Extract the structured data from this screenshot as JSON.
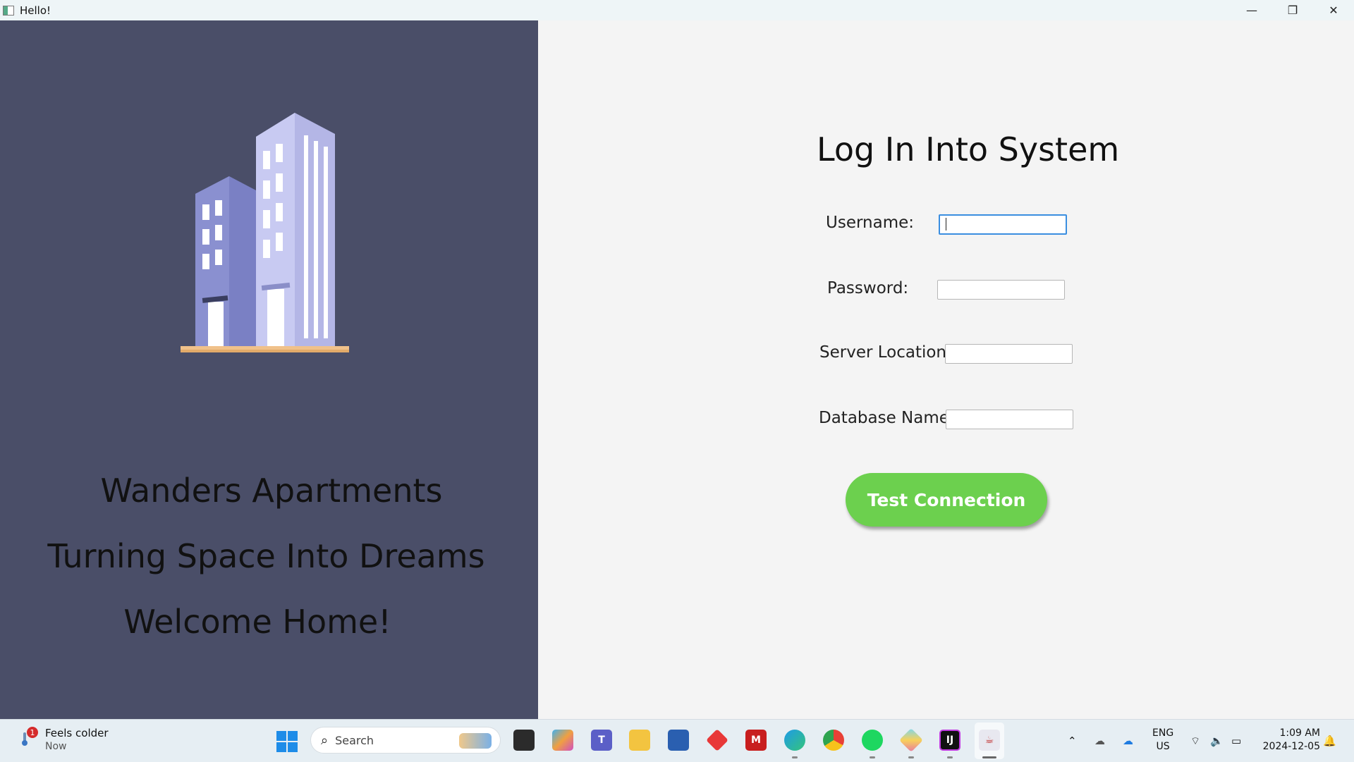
{
  "window": {
    "title": "Hello!",
    "minimize_glyph": "—",
    "maximize_glyph": "❐",
    "close_glyph": "✕"
  },
  "left_panel": {
    "lines": [
      "Wanders Apartments",
      "Turning Space Into Dreams",
      "Welcome Home!"
    ]
  },
  "form": {
    "heading": "Log In Into System",
    "fields": [
      {
        "label": "Username:",
        "value": "",
        "focused": true
      },
      {
        "label": "Password:",
        "value": ""
      },
      {
        "label": "Server Location:",
        "value": ""
      },
      {
        "label": "Database Name:",
        "value": ""
      }
    ],
    "submit_label": "Test Connection"
  },
  "taskbar": {
    "weather": {
      "text": "Feels colder",
      "time": "Now",
      "badge": "1"
    },
    "search_placeholder": "Search",
    "language": "ENG",
    "region": "US",
    "time": "1:09 AM",
    "date": "2024-12-05",
    "apps": [
      "file-explorer-app",
      "copilot-app",
      "teams-app",
      "folder-app",
      "store-app",
      "diamond-app",
      "mcafee-app",
      "edge-app",
      "chrome-app",
      "spotify-app",
      "pinwheel-app",
      "intellij-app",
      "java-app"
    ]
  },
  "colors": {
    "left_bg": "#4a4e68",
    "right_bg": "#f4f4f4",
    "button_green": "#6cd04e",
    "focus_blue": "#3a8ee0"
  }
}
